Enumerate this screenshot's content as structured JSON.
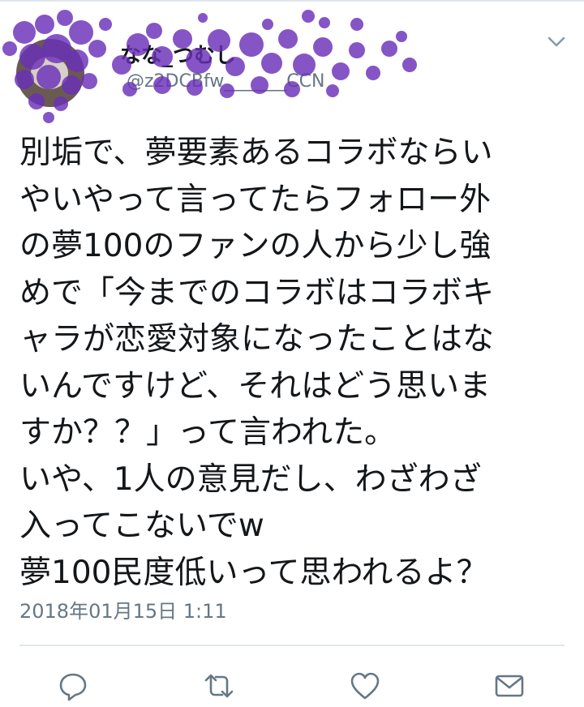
{
  "tweet": {
    "display_name": "なな_つむし",
    "handle": "@z2DCBfw_______CCN",
    "text_lines": [
      "別垢で、夢要素あるコラボならい",
      "やいやって言ってたらフォロー外",
      "の夢100のファンの人から少し強",
      "めで「今までのコラボはコラボキ",
      "ャラが恋愛対象になったことはな",
      "いんですけど、それはどう思いま",
      "すか？？」って言われた。",
      "いや、1人の意見だし、わざわざ",
      "入ってこないでw",
      "夢100民度低いって思われるよ？"
    ],
    "timestamp": "2018年01月15日 1:11"
  },
  "icons": {
    "more": "chevron-down-icon",
    "reply": "reply-icon",
    "retweet": "retweet-icon",
    "like": "heart-icon",
    "dm": "mail-icon"
  },
  "colors": {
    "scribble": "#6a2fb8",
    "secondary_text": "#657786",
    "icon": "#657786"
  }
}
